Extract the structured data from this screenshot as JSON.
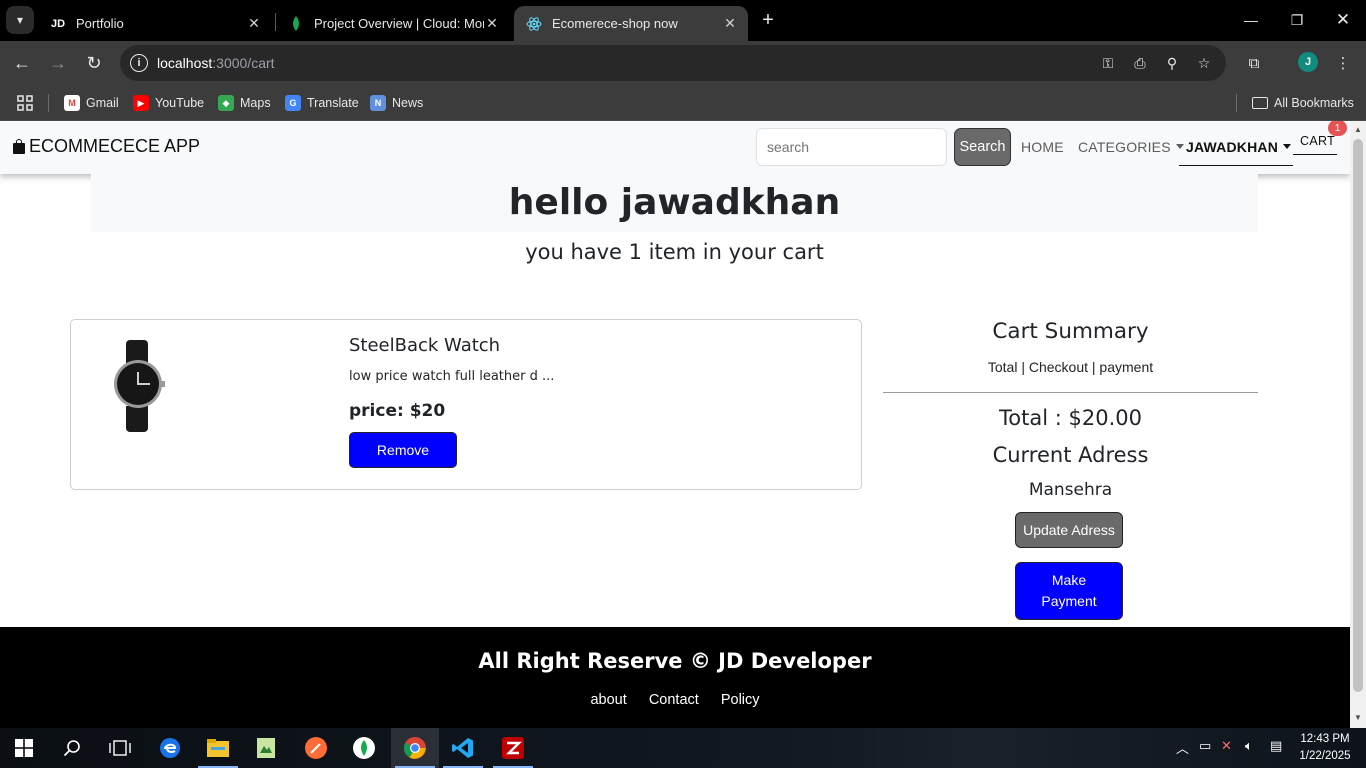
{
  "browser": {
    "tabs": [
      {
        "title": "Portfolio",
        "favicon": "JD",
        "active": false
      },
      {
        "title": "Project Overview | Cloud: MongoDB",
        "favicon": "mongodb-leaf",
        "active": false
      },
      {
        "title": "Ecomerece-shop now",
        "favicon": "react-atom",
        "active": true
      }
    ],
    "url_host": "localhost",
    "url_path": ":3000/cart",
    "profile_initial": "J",
    "bookmarks": [
      {
        "label": "Gmail",
        "icon": "gmail-icon"
      },
      {
        "label": "YouTube",
        "icon": "youtube-icon"
      },
      {
        "label": "Maps",
        "icon": "maps-icon"
      },
      {
        "label": "Translate",
        "icon": "translate-icon"
      },
      {
        "label": "News",
        "icon": "news-icon"
      }
    ],
    "all_bookmarks": "All Bookmarks"
  },
  "app": {
    "brand": "ECOMMECECE APP",
    "search_placeholder": "search",
    "search_button": "Search",
    "nav": {
      "home": "HOME",
      "categories": "CATEGORIES",
      "user": "JAWADKHAN",
      "cart": "CART",
      "cart_badge": "1"
    },
    "greeting": "hello jawadkhan",
    "cart_count_text": "you have 1 item in your cart",
    "items": [
      {
        "name": "SteelBack Watch",
        "description": "low price watch full leather d ...",
        "price_text": "price: $20",
        "remove_label": "Remove"
      }
    ],
    "summary": {
      "title": "Cart Summary",
      "subtitle": "Total | Checkout | payment",
      "total": "Total : $20.00",
      "address_title": "Current Adress",
      "address": "Mansehra",
      "update_button": "Update Adress",
      "pay_button": "Make Payment"
    },
    "footer": {
      "title": "All Right Reserve © JD Developer",
      "links": [
        "about",
        "Contact",
        "Policy"
      ]
    }
  },
  "taskbar": {
    "time": "12:43 PM",
    "date": "1/22/2025"
  },
  "colors": {
    "primary_button": "#0000ff",
    "secondary_button": "#6a6a6a",
    "badge": "#e55353",
    "footer_bg": "#000000"
  }
}
